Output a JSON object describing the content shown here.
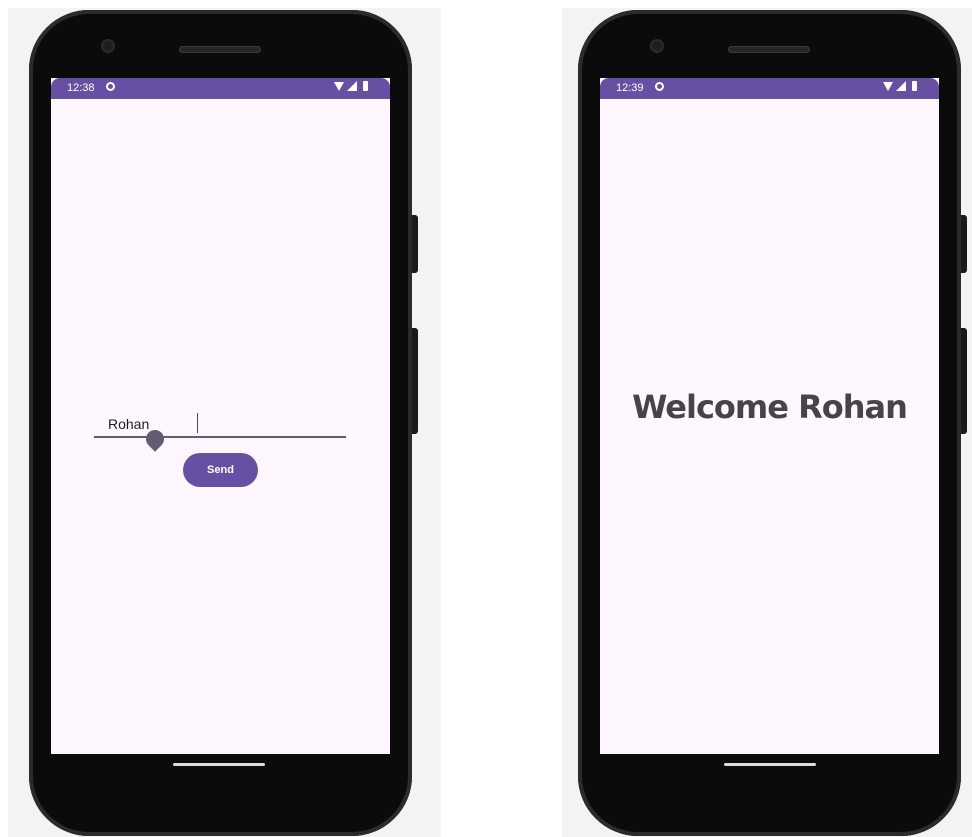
{
  "left_phone": {
    "status_bar": {
      "time": "12:38"
    },
    "text_field": {
      "value": "Rohan"
    },
    "send_button": {
      "label": "Send"
    }
  },
  "right_phone": {
    "status_bar": {
      "time": "12:39"
    },
    "welcome_text": "Welcome Rohan"
  },
  "colors": {
    "accent": "#6750a4",
    "screen_background": "#fef7ff",
    "welcome_text": "#46444a",
    "underline": "#625b71"
  },
  "icons": [
    "circle-status-icon",
    "wifi-icon",
    "signal-icon",
    "battery-icon",
    "cursor-handle-icon"
  ]
}
